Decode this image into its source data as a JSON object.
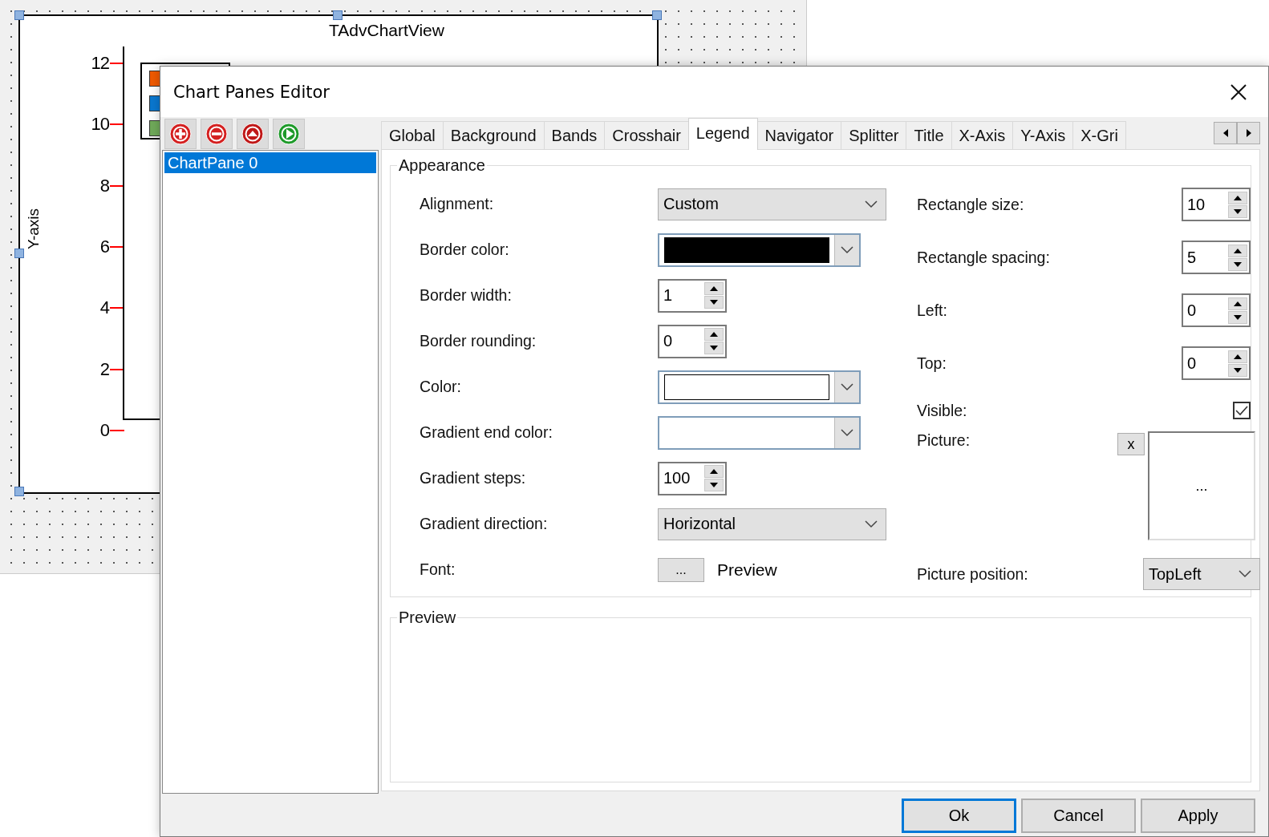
{
  "designer": {
    "chart_view": {
      "title": "TAdvChartView",
      "y_axis_label": "Y-axis",
      "y_ticks": [
        "12",
        "10",
        "8",
        "6",
        "4",
        "2",
        "0"
      ],
      "legend_items": [
        {
          "color": "#f05a00"
        },
        {
          "color": "#0a78d0"
        },
        {
          "color": "#70aa5a"
        }
      ]
    }
  },
  "dialog": {
    "title": "Chart Panes Editor",
    "panes": [
      {
        "label": "ChartPane 0",
        "selected": true
      }
    ],
    "tabs": [
      {
        "label": "Global",
        "selected": false
      },
      {
        "label": "Background",
        "selected": false
      },
      {
        "label": "Bands",
        "selected": false
      },
      {
        "label": "Crosshair",
        "selected": false
      },
      {
        "label": "Legend",
        "selected": true
      },
      {
        "label": "Navigator",
        "selected": false
      },
      {
        "label": "Splitter",
        "selected": false
      },
      {
        "label": "Title",
        "selected": false
      },
      {
        "label": "X-Axis",
        "selected": false
      },
      {
        "label": "Y-Axis",
        "selected": false
      },
      {
        "label": "X-Gri",
        "selected": false
      }
    ],
    "appearance": {
      "title": "Appearance",
      "left_fields": [
        {
          "kind": "dropdown",
          "label": "Alignment:",
          "value": "Custom"
        },
        {
          "kind": "color",
          "label": "Border color:",
          "color": "#000000"
        },
        {
          "kind": "spin",
          "label": "Border width:",
          "value": "1"
        },
        {
          "kind": "spin",
          "label": "Border rounding:",
          "value": "0"
        },
        {
          "kind": "color",
          "label": "Color:",
          "color": "#ffffff"
        },
        {
          "kind": "color",
          "label": "Gradient end color:"
        },
        {
          "kind": "spin",
          "label": "Gradient steps:",
          "value": "100"
        },
        {
          "kind": "dropdown",
          "label": "Gradient direction:",
          "value": "Horizontal"
        },
        {
          "kind": "font",
          "label": "Font:",
          "button": "...",
          "sample": "Preview"
        }
      ],
      "right_fields": [
        {
          "kind": "spin",
          "label": "Rectangle size:",
          "value": "10"
        },
        {
          "kind": "spin",
          "label": "Rectangle spacing:",
          "value": "5"
        },
        {
          "kind": "spin",
          "label": "Left:",
          "value": "0"
        },
        {
          "kind": "spin",
          "label": "Top:",
          "value": "0"
        },
        {
          "kind": "checkbox",
          "label": "Visible:",
          "checked": true
        },
        {
          "kind": "picture",
          "label": "Picture:",
          "clear": "x",
          "browse": "..."
        },
        {
          "kind": "dropdown",
          "label": "Picture position:",
          "value": "TopLeft"
        }
      ]
    },
    "preview": {
      "title": "Preview"
    },
    "buttons": [
      {
        "label": "Ok",
        "default": true
      },
      {
        "label": "Cancel",
        "default": false
      },
      {
        "label": "Apply",
        "default": false
      }
    ]
  }
}
